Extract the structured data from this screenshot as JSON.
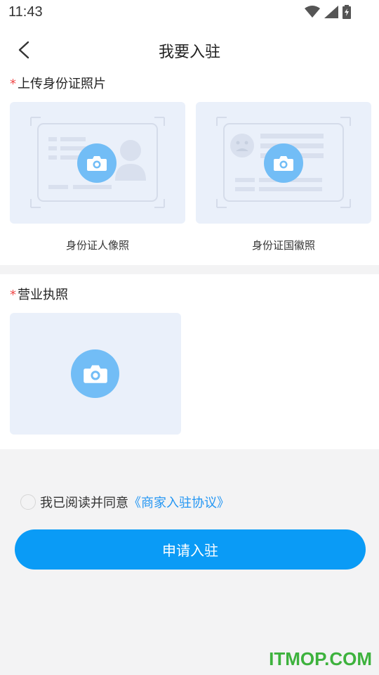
{
  "status_bar": {
    "time": "11:43"
  },
  "nav": {
    "title": "我要入驻"
  },
  "id_section": {
    "required_mark": "*",
    "label": "上传身份证照片",
    "front_caption": "身份证人像照",
    "back_caption": "身份证国徽照"
  },
  "license_section": {
    "required_mark": "*",
    "label": "营业执照"
  },
  "agreement": {
    "text": "我已阅读并同意",
    "link": "《商家入驻协议》",
    "checked": false
  },
  "submit": {
    "label": "申请入驻"
  },
  "watermark": {
    "text": "ITMOP.COM"
  },
  "colors": {
    "accent": "#0a9bf6",
    "link": "#2396f3",
    "required": "#f04a4a",
    "card_bg": "#eaf0fa",
    "camera_circle": "#72bdf6"
  }
}
